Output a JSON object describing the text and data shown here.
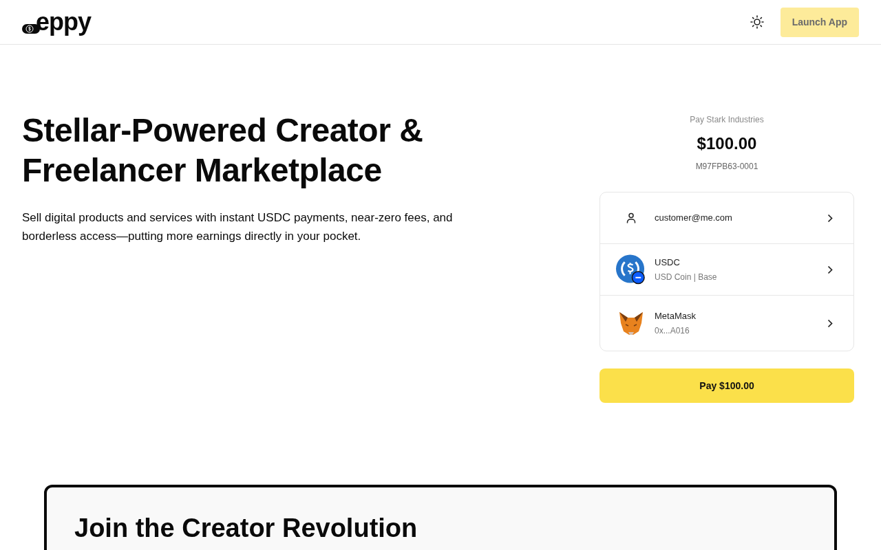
{
  "header": {
    "logo": "eppy",
    "launch_button": "Launch App"
  },
  "hero": {
    "title": "Stellar-Powered Creator & Freelancer Marketplace",
    "subtitle": "Sell digital products and services with instant USDC payments, near-zero fees, and borderless access—putting more earnings directly in your pocket."
  },
  "payment": {
    "payee": "Pay Stark Industries",
    "amount": "$100.00",
    "reference": "M97FPB63-0001",
    "rows": [
      {
        "kind": "account",
        "title": "customer@me.com"
      },
      {
        "kind": "token",
        "title": "USDC",
        "subtitle": "USD Coin | Base"
      },
      {
        "kind": "wallet",
        "title": "MetaMask",
        "subtitle": "0x...A016"
      }
    ],
    "pay_button": "Pay $100.00"
  },
  "cta": {
    "title": "Join the Creator Revolution"
  }
}
